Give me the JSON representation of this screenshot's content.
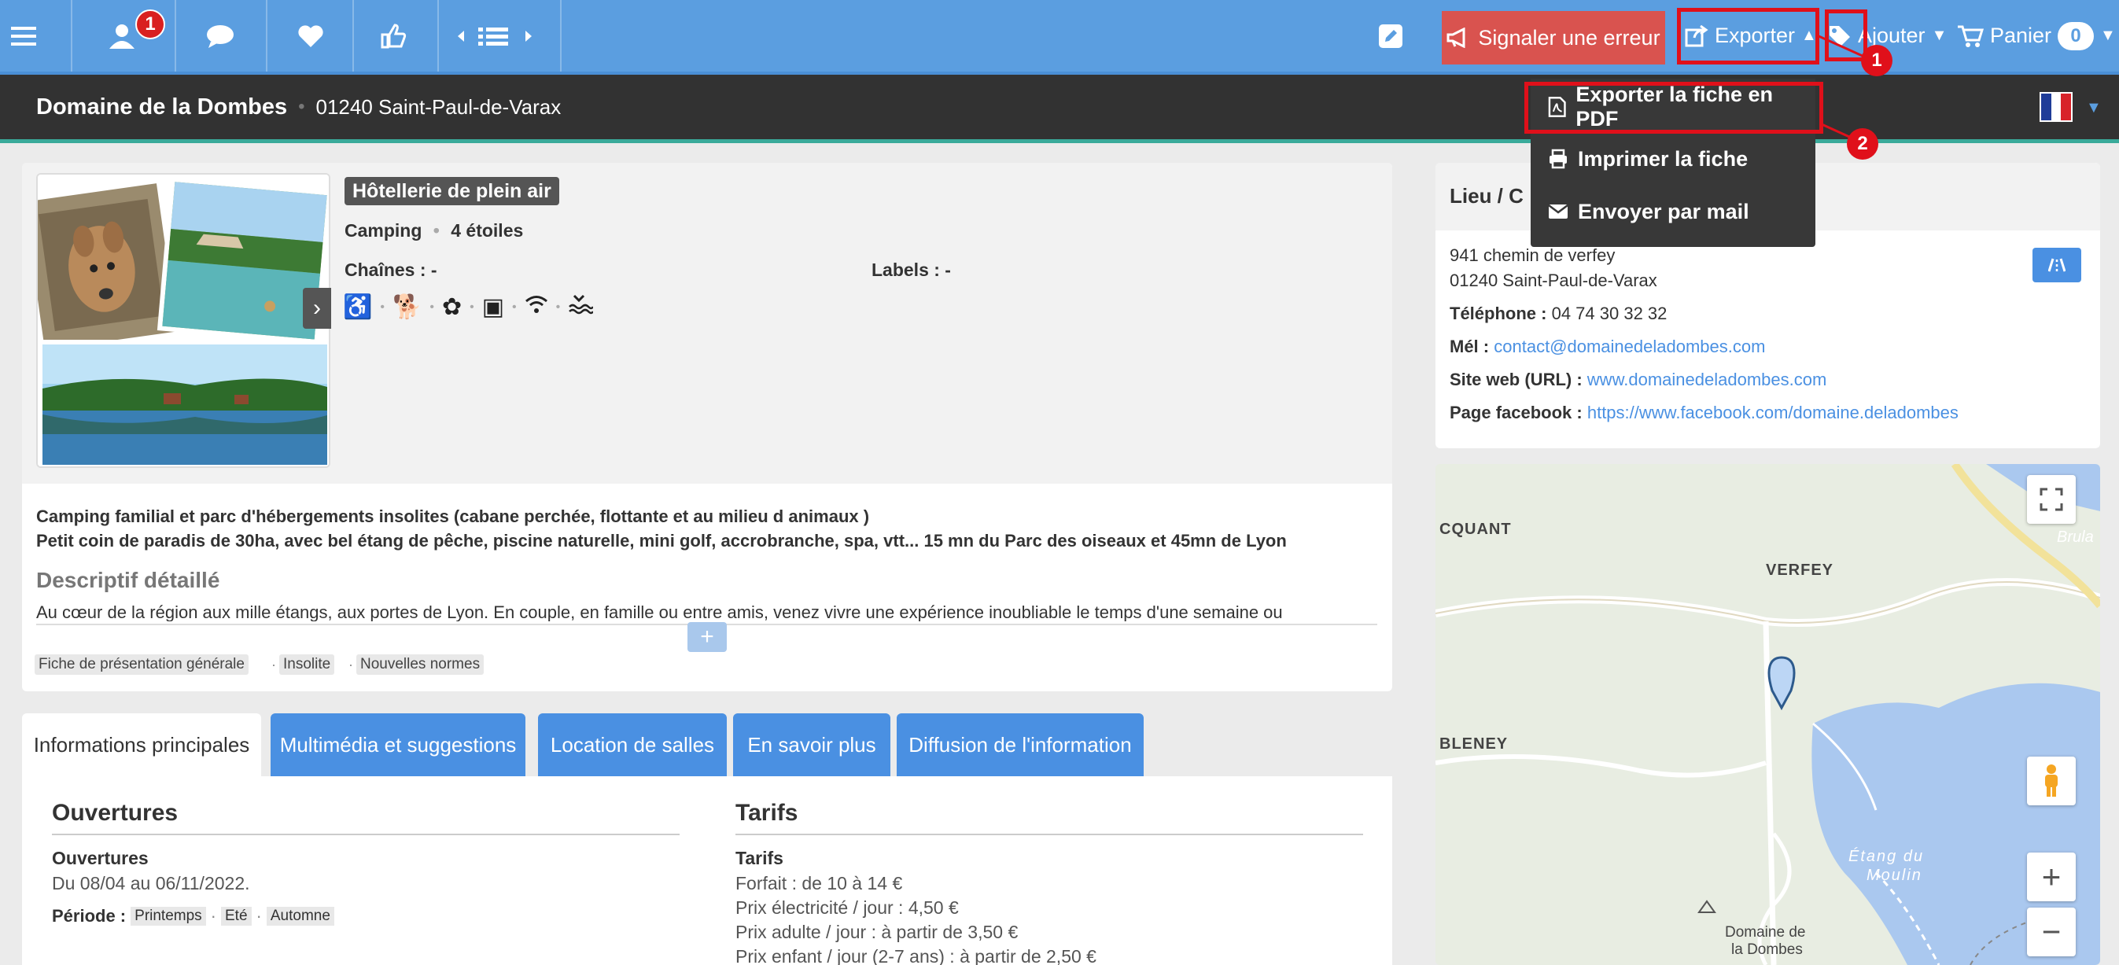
{
  "topbar": {
    "notification_count": "1",
    "signal_label": "Signaler une erreur",
    "export_label": "Exporter",
    "add_label": "Ajouter",
    "cart_label": "Panier",
    "cart_count": "0",
    "markers": [
      "1",
      "2"
    ]
  },
  "header": {
    "title": "Domaine de la Dombes",
    "address": "01240 Saint-Paul-de-Varax"
  },
  "export_menu": {
    "items": [
      "Exporter la fiche en PDF",
      "Imprimer la fiche",
      "Envoyer par mail"
    ]
  },
  "listing": {
    "category": "Hôtellerie de plein air",
    "type": "Camping",
    "stars": "4 étoiles",
    "chains_label": "Chaînes : -",
    "labels_label": "Labels : -",
    "desc_line1": "Camping familial et parc d'hébergements insolites (cabane perchée, flottante et au milieu d animaux )",
    "desc_line2": "Petit coin de paradis de 30ha, avec bel étang de pêche, piscine naturelle, mini golf, accrobranche, spa, vtt... 15 mn du Parc des oiseaux et 45mn de Lyon",
    "detailed_heading": "Descriptif détaillé",
    "detailed_text": "Au cœur de la région aux mille étangs, aux portes de Lyon. En couple, en famille ou entre amis, venez vivre une expérience inoubliable le temps d'une semaine ou",
    "tags": [
      "Fiche de présentation générale",
      "Insolite",
      "Nouvelles normes"
    ]
  },
  "tabs": [
    {
      "label": "Informations principales"
    },
    {
      "label": "Multimédia et suggestions"
    },
    {
      "label": "Location de salles"
    },
    {
      "label": "En savoir plus"
    },
    {
      "label": "Diffusion de l'information"
    }
  ],
  "openings": {
    "heading": "Ouvertures",
    "subheading": "Ouvertures",
    "dates": "Du 08/04 au 06/11/2022.",
    "period_label": "Période :",
    "periods": [
      "Printemps",
      "Eté",
      "Automne"
    ]
  },
  "rates": {
    "heading": "Tarifs",
    "subheading": "Tarifs",
    "lines": [
      "Forfait : de 10 à 14 €",
      "Prix électricité / jour : 4,50 €",
      "Prix adulte / jour : à partir de 3,50 €",
      "Prix enfant / jour (2-7 ans) : à partir de 2,50 €"
    ]
  },
  "location": {
    "heading_visible": "Lieu / C",
    "street": "941 chemin de verfey",
    "city": "01240 Saint-Paul-de-Varax",
    "phone_label": "Téléphone :",
    "phone": "04 74 30 32 32",
    "mail_label": "Mél :",
    "mail": "contact@domainedeladombes.com",
    "site_label": "Site web (URL) :",
    "site": "www.domainedeladombes.com",
    "fb_label": "Page facebook :",
    "fb": "https://www.facebook.com/domaine.deladombes"
  },
  "map": {
    "labels": [
      "CQUANT",
      "VERFEY",
      "BLENEY",
      "Étang du",
      "Moulin",
      "Brula",
      "Domaine de",
      "la Dombes"
    ]
  }
}
